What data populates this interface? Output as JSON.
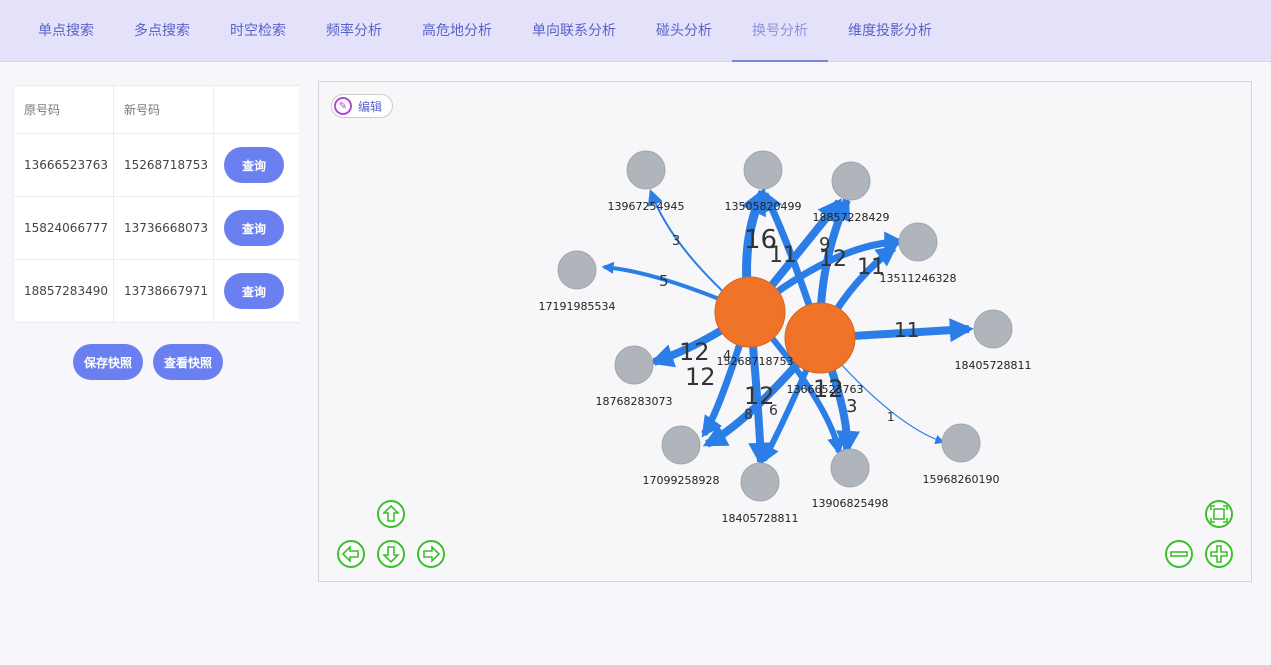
{
  "tabs": [
    {
      "label": "单点搜索"
    },
    {
      "label": "多点搜索"
    },
    {
      "label": "时空检索"
    },
    {
      "label": "频率分析"
    },
    {
      "label": "高危地分析"
    },
    {
      "label": "单向联系分析"
    },
    {
      "label": "碰头分析"
    },
    {
      "label": "换号分析"
    },
    {
      "label": "维度投影分析"
    }
  ],
  "active_tab": "换号分析",
  "table": {
    "headers": {
      "original": "原号码",
      "new": "新号码",
      "action": ""
    },
    "rows": [
      {
        "original": "13666523763",
        "new": "15268718753",
        "action": "查询"
      },
      {
        "original": "15824066777",
        "new": "13736668073",
        "action": "查询"
      },
      {
        "original": "18857283490",
        "new": "13738667971",
        "action": "查询"
      }
    ]
  },
  "buttons": {
    "save_snapshot": "保存快照",
    "view_snapshot": "查看快照"
  },
  "graph": {
    "edit_label": "编辑",
    "accent": "#2b7ee6",
    "center_color": "#f07427",
    "leaf_color": "#b0b5bc",
    "centers": [
      {
        "id": "15268718753",
        "label": "15268718753"
      },
      {
        "id": "13666523763",
        "label": "13666523763"
      }
    ],
    "leaves": [
      {
        "label": "13967254945"
      },
      {
        "label": "13505820499"
      },
      {
        "label": "18857228429"
      },
      {
        "label": "13511246328"
      },
      {
        "label": "17191985534"
      },
      {
        "label": "18405728811"
      },
      {
        "label": "18768283073"
      },
      {
        "label": "17099258928"
      },
      {
        "label": "18405728811"
      },
      {
        "label": "13906825498"
      },
      {
        "label": "15968260190"
      }
    ],
    "edge_labels": {
      "a": "3",
      "b": "16",
      "c": "11",
      "d": "9",
      "e": "12",
      "f": "11",
      "g": "5",
      "h": "11",
      "i": "12",
      "j": "12",
      "k": "12",
      "l": "8",
      "m": "6",
      "n": "12",
      "o": "3",
      "p": "1",
      "q": "4"
    },
    "controls": {
      "up": "arrow-up-icon",
      "down": "arrow-down-icon",
      "left": "arrow-left-icon",
      "right": "arrow-right-icon",
      "fit": "fit-screen-icon",
      "zoom_out": "zoom-out-icon",
      "zoom_in": "zoom-in-icon"
    }
  }
}
